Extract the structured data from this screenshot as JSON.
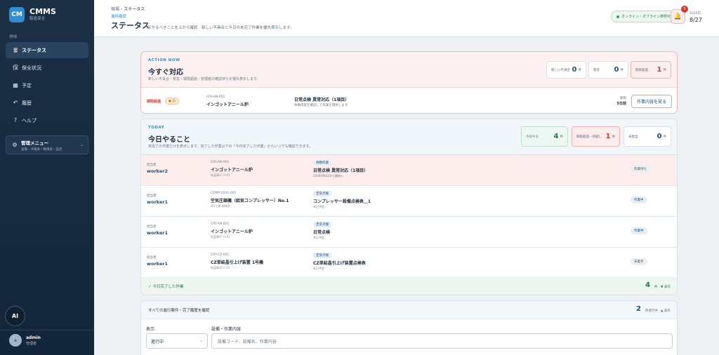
{
  "brand": {
    "logo": "CM",
    "name": "CMMS",
    "sub": "製造保全"
  },
  "sidebar": {
    "section": "現場",
    "items": [
      {
        "icon": "list-icon",
        "glyph": "≣",
        "label": "ステータス",
        "active": true
      },
      {
        "icon": "maintenance-icon",
        "glyph": "保",
        "label": "保全状況",
        "active": false
      },
      {
        "icon": "calendar-icon",
        "glyph": "▦",
        "label": "予定",
        "active": false
      },
      {
        "icon": "history-icon",
        "glyph": "↶",
        "label": "履歴",
        "active": false
      },
      {
        "icon": "help-icon",
        "glyph": "?",
        "label": "ヘルプ",
        "active": false
      }
    ],
    "admin_title": "管理メニュー",
    "admin_sub": "設備・点検表・権限表・設定",
    "ai_label": "AI",
    "user": {
      "avatar": "a",
      "name": "admin",
      "role": "管理者"
    }
  },
  "header": {
    "crumb_home": "現場",
    "crumb_sep": "›",
    "crumb_current": "ステータス",
    "kicker": "進捗確認",
    "title": "ステータス",
    "desc": "今やるべきことを上から確認　新しい不具合と今日の未完了作業を優先表示します。",
    "online": "オンライン・オフライン参照可",
    "notif_count": "5",
    "year": "2026年",
    "date": "8/27"
  },
  "action": {
    "kicker": "ACTION NOW",
    "title": "今すぐ対応",
    "desc": "新しい不具合・緊急・期限超過・管理者の確認待ちを優先表示します。",
    "stats": [
      {
        "label": "新しい不具合",
        "num": "0",
        "unit": "件"
      },
      {
        "label": "緊急",
        "num": "0",
        "unit": "件"
      },
      {
        "label": "期限超過",
        "num": "1",
        "unit": "件"
      }
    ],
    "row": {
      "overdue": "期限超過",
      "priority": "● 高",
      "code": "CRY-AN-001",
      "name": "インゴットアニール炉",
      "task": "日常点検 異常対応（1項目）",
      "task_sub": "依頼内容を確認して作業を開始します",
      "due_label": "期限",
      "due": "5日前",
      "button": "作業内容を見る"
    }
  },
  "today": {
    "kicker": "TODAY",
    "title": "今日やること",
    "desc": "未完了の作業だけを表示します。完了した作業は下の「今日完了した作業」からいつでも確認できます。",
    "stats": [
      {
        "label": "今日やる",
        "num": "4",
        "unit": "件"
      },
      {
        "label": "期限超過・持越し",
        "num": "1",
        "unit": "件"
      },
      {
        "label": "未割当",
        "num": "0",
        "unit": "件"
      }
    ],
    "assignee_label": "担当者",
    "rows": [
      {
        "who": "worker2",
        "code": "CRY-AN-001",
        "name": "インゴットアニール炉",
        "loc": "結晶棟2F H-01",
        "tag": "依頼作業",
        "task": "日常点検 異常対応（1項目）",
        "sub": "2026/08/22から開始い",
        "status": "作業待ち",
        "hl": true
      },
      {
        "who": "worker1",
        "code": "COMP-2021-001",
        "name": "空気圧縮機（給気コンプレッサー）No.1",
        "loc": "第1工場 機械室",
        "tag": "定常点検",
        "task": "コンプレッサー設備点検表＿1",
        "sub": "本日予定",
        "status": "作業中",
        "hl": false
      },
      {
        "who": "worker1",
        "code": "CRY-AN-001",
        "name": "インゴットアニール炉",
        "loc": "結晶棟2F H-01",
        "tag": "定常点検",
        "task": "日常点検",
        "sub": "本日予定",
        "status": "作業中",
        "hl": false
      },
      {
        "who": "worker1",
        "code": "CRY-CZ-001",
        "name": "CZ単結晶引上げ装置 1号機",
        "loc": "結晶棟1F C-01",
        "tag": "定常点検",
        "task": "CZ単結晶引上げ装置点検表",
        "sub": "本日予定",
        "status": "未着手",
        "hl": false
      }
    ],
    "done_label": "✓ 今日完了した作業",
    "done_num": "4",
    "done_unit": "件",
    "done_toggle": "▼ 表示"
  },
  "all": {
    "title": "すべての進行案件・完了履歴を確認",
    "num": "2",
    "unit": "件進行中",
    "toggle": "▲ 表示",
    "filter_label": "表示",
    "search_label": "設備・作業内容",
    "select_value": "進行中",
    "search_placeholder": "設備コード、設備名、作業内容"
  }
}
